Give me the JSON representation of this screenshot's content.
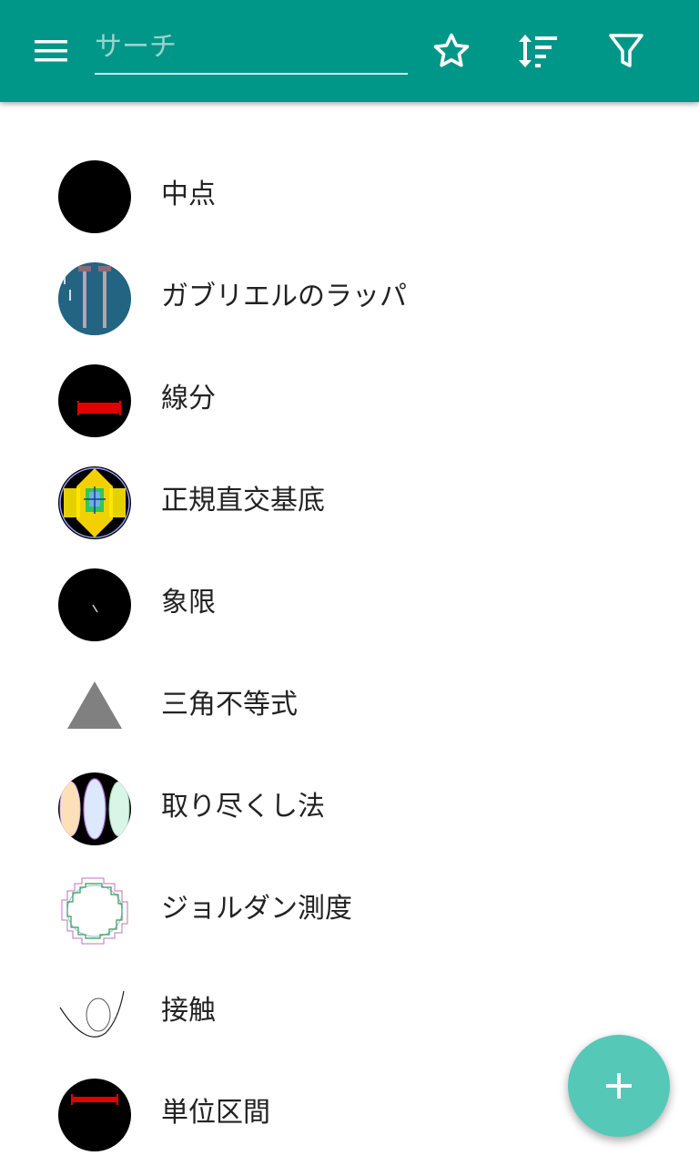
{
  "appbar": {
    "menu_icon": "menu-icon",
    "search_placeholder": "サーチ",
    "favorite_icon": "star-outline-icon",
    "sort_icon": "sort-icon",
    "filter_icon": "filter-icon",
    "color": "#009688"
  },
  "list": {
    "items": [
      {
        "label": "中点",
        "icon": "midpoint-thumbnail"
      },
      {
        "label": "ガブリエルのラッパ",
        "icon": "gabriels-horn-thumbnail"
      },
      {
        "label": "線分",
        "icon": "line-segment-thumbnail"
      },
      {
        "label": "正規直交基底",
        "icon": "orthonormal-basis-thumbnail"
      },
      {
        "label": "象限",
        "icon": "quadrant-thumbnail"
      },
      {
        "label": "三角不等式",
        "icon": "triangle-thumbnail"
      },
      {
        "label": "取り尽くし法",
        "icon": "exhaustion-thumbnail"
      },
      {
        "label": "ジョルダン測度",
        "icon": "jordan-measure-thumbnail"
      },
      {
        "label": "接触",
        "icon": "contact-thumbnail"
      },
      {
        "label": "単位区間",
        "icon": "unit-interval-thumbnail"
      }
    ]
  },
  "fab": {
    "icon": "plus-icon",
    "color": "#55c8b8"
  }
}
